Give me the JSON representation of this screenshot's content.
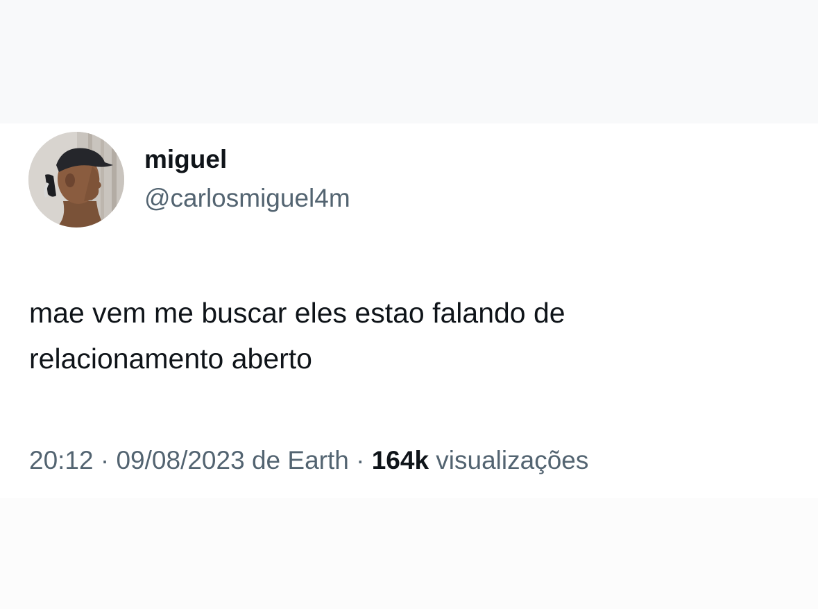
{
  "author": {
    "display_name": "miguel",
    "handle": "@carlosmiguel4m",
    "avatar_icon": "profile-photo"
  },
  "tweet": {
    "text_lines": [
      "mae vem me buscar eles estao falando de",
      "relacionamento aberto"
    ]
  },
  "meta": {
    "time": "20:12",
    "separator": " · ",
    "date": "09/08/2023",
    "source": " de Earth",
    "separator2": " · ",
    "views_count": "164k",
    "views_label": " visualizações"
  },
  "colors": {
    "primary_text": "#0f1419",
    "secondary_text": "#536471",
    "background": "#ffffff"
  }
}
